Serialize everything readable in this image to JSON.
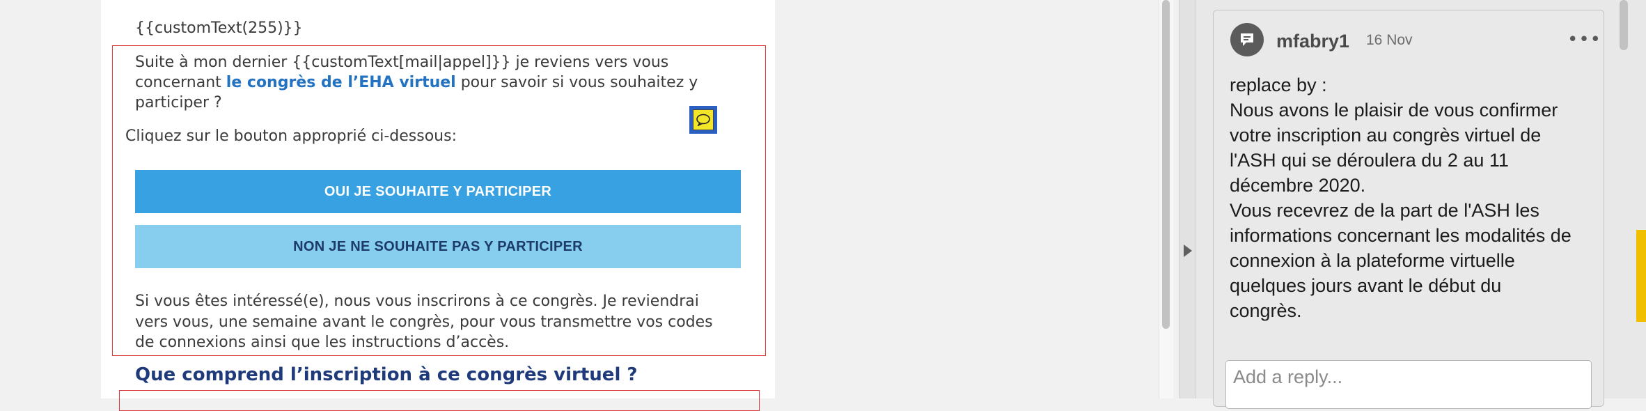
{
  "document": {
    "header_snippet": "{{customText(255)}}",
    "intro_lines": {
      "line1": "Suite à mon dernier {{customText[mail|appel]}} je reviens vers vous",
      "line2_pre": "concernant ",
      "line2_link": "le congrès de l’EHA virtuel",
      "line2_post": " pour savoir si vous souhaitez y",
      "line3": "participer ?"
    },
    "instruction": "Cliquez sur le bouton approprié ci-dessous:",
    "button_yes": "OUI JE SOUHAITE Y PARTICIPER",
    "button_no": "NON JE NE SOUHAITE PAS Y PARTICIPER",
    "closing_lines": [
      "Si vous êtes intéressé(e), nous vous inscrirons à ce congrès. Je reviendrai",
      "vers vous, une semaine avant le congrès, pour vous transmettre vos codes",
      "de connexions ainsi que les instructions d’accès."
    ],
    "section_title": "Que comprend l’inscription à ce congrès virtuel ?"
  },
  "comments_panel": {
    "comment": {
      "author": "mfabry1",
      "date": "16 Nov",
      "more_label": "•••",
      "body_lines": [
        "replace by :",
        "Nous avons le plaisir de vous confirmer",
        "votre inscription au congrès virtuel de",
        "l'ASH qui se déroulera du 2 au 11",
        "décembre 2020.",
        "Vous recevrez de la part de l'ASH les",
        "informations concernant les modalités de",
        "connexion à la plateforme virtuelle",
        "quelques jours avant le début du",
        "congrès."
      ]
    },
    "reply_placeholder": "Add a reply..."
  },
  "colors": {
    "link": "#2473c2",
    "annotation_border": "#e0393b",
    "button_yes": "#37a1e1",
    "button_no": "#86cdee",
    "section_title": "#1f3a7a"
  },
  "icons": {
    "comment_marker": "speech-bubble-icon",
    "avatar": "comment-bubble-icon",
    "collapse": "triangle-right-icon",
    "more": "more-horizontal-icon"
  }
}
